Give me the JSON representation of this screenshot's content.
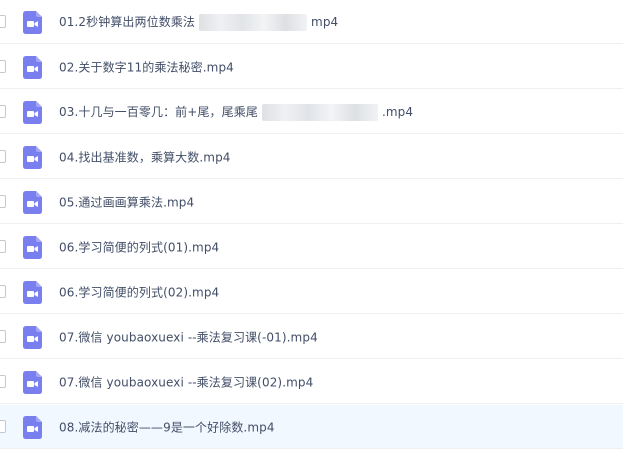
{
  "files": [
    {
      "name": "01.2秒钟算出两位数乘法",
      "suffix": "mp4"
    },
    {
      "name": "02.关于数字11的乘法秘密.mp4",
      "suffix": ""
    },
    {
      "name": "03.十几与一百零几：前+尾，尾乘尾",
      "suffix": ".mp4"
    },
    {
      "name": "04.找出基准数，乘算大数.mp4",
      "suffix": ""
    },
    {
      "name": "05.通过画画算乘法.mp4",
      "suffix": ""
    },
    {
      "name": "06.学习简便的列式(01).mp4",
      "suffix": ""
    },
    {
      "name": "06.学习简便的列式(02).mp4",
      "suffix": ""
    },
    {
      "name": "07.微信 youbaoxuexi --乘法复习课(-01).mp4",
      "suffix": ""
    },
    {
      "name": "07.微信 youbaoxuexi --乘法复习课(02).mp4",
      "suffix": ""
    },
    {
      "name": "08.减法的秘密——9是一个好除数.mp4",
      "suffix": ""
    }
  ],
  "colors": {
    "icon_bg": "#7a7ff0",
    "text": "#424e67",
    "hover_bg": "#f2f8ff"
  },
  "icon": "video-file-icon"
}
